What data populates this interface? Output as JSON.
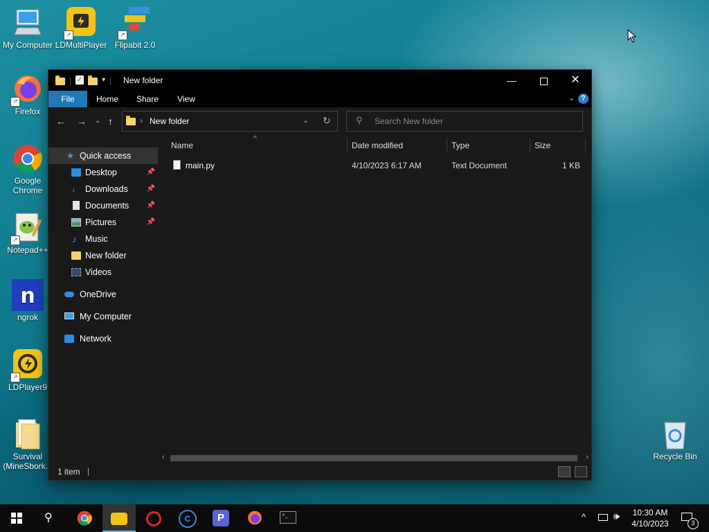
{
  "desktop": {
    "icons": [
      {
        "label": "My Computer"
      },
      {
        "label": "LDMultiPlayer"
      },
      {
        "label": "Flipabit 2.0"
      },
      {
        "label": "Firefox"
      },
      {
        "label": "Google Chrome"
      },
      {
        "label": "Notepad++"
      },
      {
        "label": "ngrok"
      },
      {
        "label": "LDPlayer9"
      },
      {
        "label": "Survival (MineSbork..."
      },
      {
        "label": "Recycle Bin"
      }
    ]
  },
  "window": {
    "title": "New folder",
    "ribbon_tabs": [
      "File",
      "Home",
      "Share",
      "View"
    ],
    "address": {
      "path": "New folder"
    },
    "search": {
      "placeholder": "Search New folder"
    },
    "sidebar": {
      "quick_access": "Quick access",
      "items": [
        {
          "label": "Desktop",
          "pinned": true
        },
        {
          "label": "Downloads",
          "pinned": true
        },
        {
          "label": "Documents",
          "pinned": true
        },
        {
          "label": "Pictures",
          "pinned": true
        },
        {
          "label": "Music",
          "pinned": false
        },
        {
          "label": "New folder",
          "pinned": false
        },
        {
          "label": "Videos",
          "pinned": false
        }
      ],
      "onedrive": "OneDrive",
      "my_computer": "My Computer",
      "network": "Network"
    },
    "columns": {
      "name": "Name",
      "date_modified": "Date modified",
      "type": "Type",
      "size": "Size"
    },
    "files": [
      {
        "name": "main.py",
        "date_modified": "4/10/2023 6:17 AM",
        "type": "Text Document",
        "size": "1 KB"
      }
    ],
    "status": {
      "item_count": "1 item"
    }
  },
  "taskbar": {
    "time": "10:30 AM",
    "date": "4/10/2023",
    "notifications": "3"
  },
  "colors": {
    "window_bg": "#191919",
    "titlebar_bg": "#000000",
    "file_tab": "#1f79b4",
    "selected_bg": "#333333",
    "folder": "#f6d46b"
  }
}
